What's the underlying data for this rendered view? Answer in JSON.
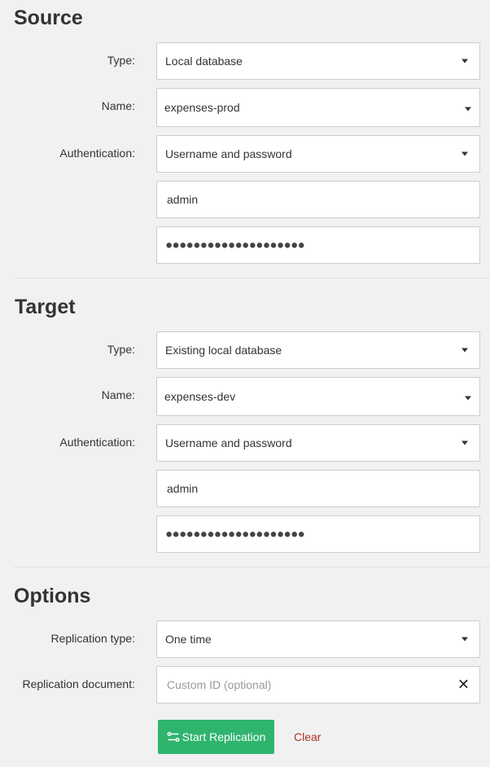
{
  "source": {
    "title": "Source",
    "type_label": "Type:",
    "type_value": "Local database",
    "name_label": "Name:",
    "name_value": "expenses-prod",
    "auth_label": "Authentication:",
    "auth_value": "Username and password",
    "username_value": "admin",
    "password_value": "●●●●●●●●●●●●●●●●●●●●"
  },
  "target": {
    "title": "Target",
    "type_label": "Type:",
    "type_value": "Existing local database",
    "name_label": "Name:",
    "name_value": "expenses-dev",
    "auth_label": "Authentication:",
    "auth_value": "Username and password",
    "username_value": "admin",
    "password_value": "●●●●●●●●●●●●●●●●●●●●"
  },
  "options": {
    "title": "Options",
    "replication_type_label": "Replication type:",
    "replication_type_value": "One time",
    "replication_doc_label": "Replication document:",
    "replication_doc_placeholder": "Custom ID (optional)"
  },
  "actions": {
    "start_label": "Start Replication",
    "clear_label": "Clear"
  },
  "colors": {
    "background": "#f1f1f1",
    "start_button": "#2fb46e",
    "clear_link": "#b0312c"
  },
  "icons": {
    "start_button_icon": "replication-icon",
    "clear_input_icon": "close-icon",
    "dropdown_icon": "caret-down-icon"
  }
}
